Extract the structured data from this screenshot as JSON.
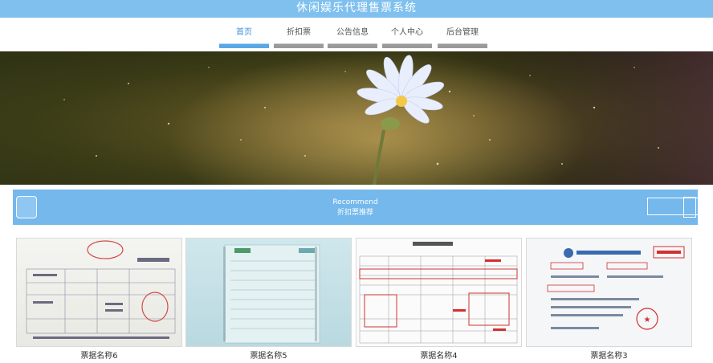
{
  "header": {
    "title": "休闲娱乐代理售票系统"
  },
  "nav": {
    "items": [
      {
        "label": "首页",
        "active": true
      },
      {
        "label": "折扣票",
        "active": false
      },
      {
        "label": "公告信息",
        "active": false
      },
      {
        "label": "个人中心",
        "active": false
      },
      {
        "label": "后台管理",
        "active": false
      }
    ]
  },
  "recommend": {
    "title": "Recommend",
    "subtitle": "折扣票推荐"
  },
  "cards": [
    {
      "caption": "票据名称6"
    },
    {
      "caption": "票据名称5"
    },
    {
      "caption": "票据名称4"
    },
    {
      "caption": "票据名称3"
    }
  ],
  "colors": {
    "accent": "#74b8ec",
    "header": "#7fc0ef",
    "nav_active": "#5aa7e6",
    "nav_inactive": "#9a9a9a"
  }
}
